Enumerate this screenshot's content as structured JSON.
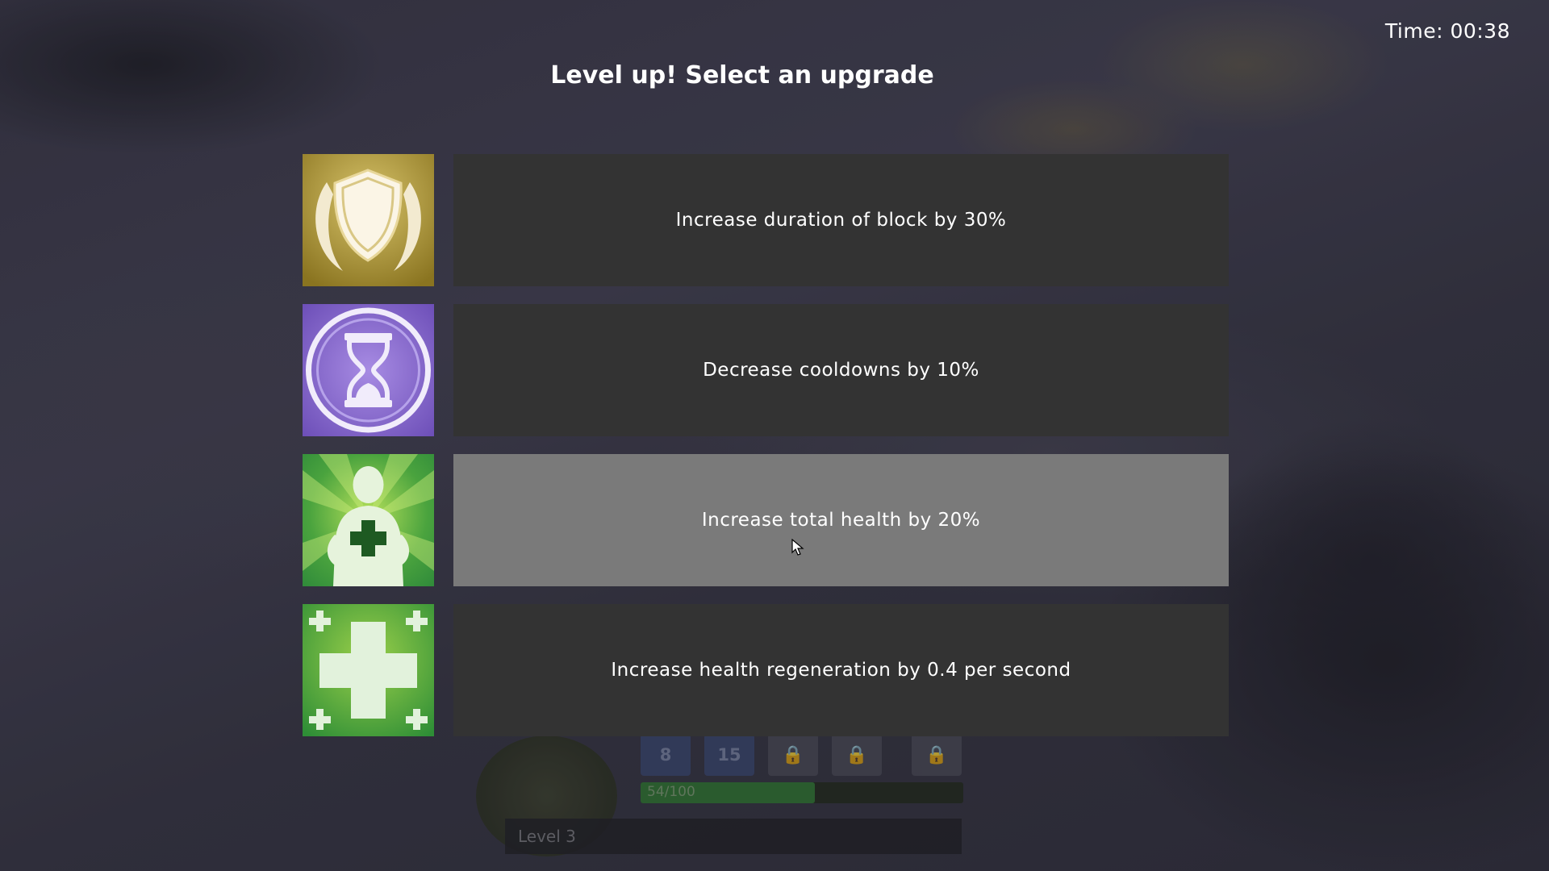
{
  "timer": {
    "text": "Time: 00:38"
  },
  "heading": "Level up! Select an upgrade",
  "options": [
    {
      "label": "Increase duration of block by 30%",
      "icon": "shield-icon",
      "color": "#9a8a2c",
      "hovered": false
    },
    {
      "label": "Decrease cooldowns by 10%",
      "icon": "hourglass-icon",
      "color": "#7d5fc4",
      "hovered": false
    },
    {
      "label": "Increase total health by 20%",
      "icon": "health-body-icon",
      "color": "#3e9a3a",
      "hovered": true
    },
    {
      "label": "Increase health regeneration by 0.4 per second",
      "icon": "regen-cross-icon",
      "color": "#2f8f36",
      "hovered": false
    }
  ],
  "hud": {
    "slots": [
      "8",
      "15"
    ],
    "locked_slots": 3,
    "xp": {
      "text": "54/100",
      "current": 54,
      "max": 100
    },
    "level": "Level 3"
  }
}
